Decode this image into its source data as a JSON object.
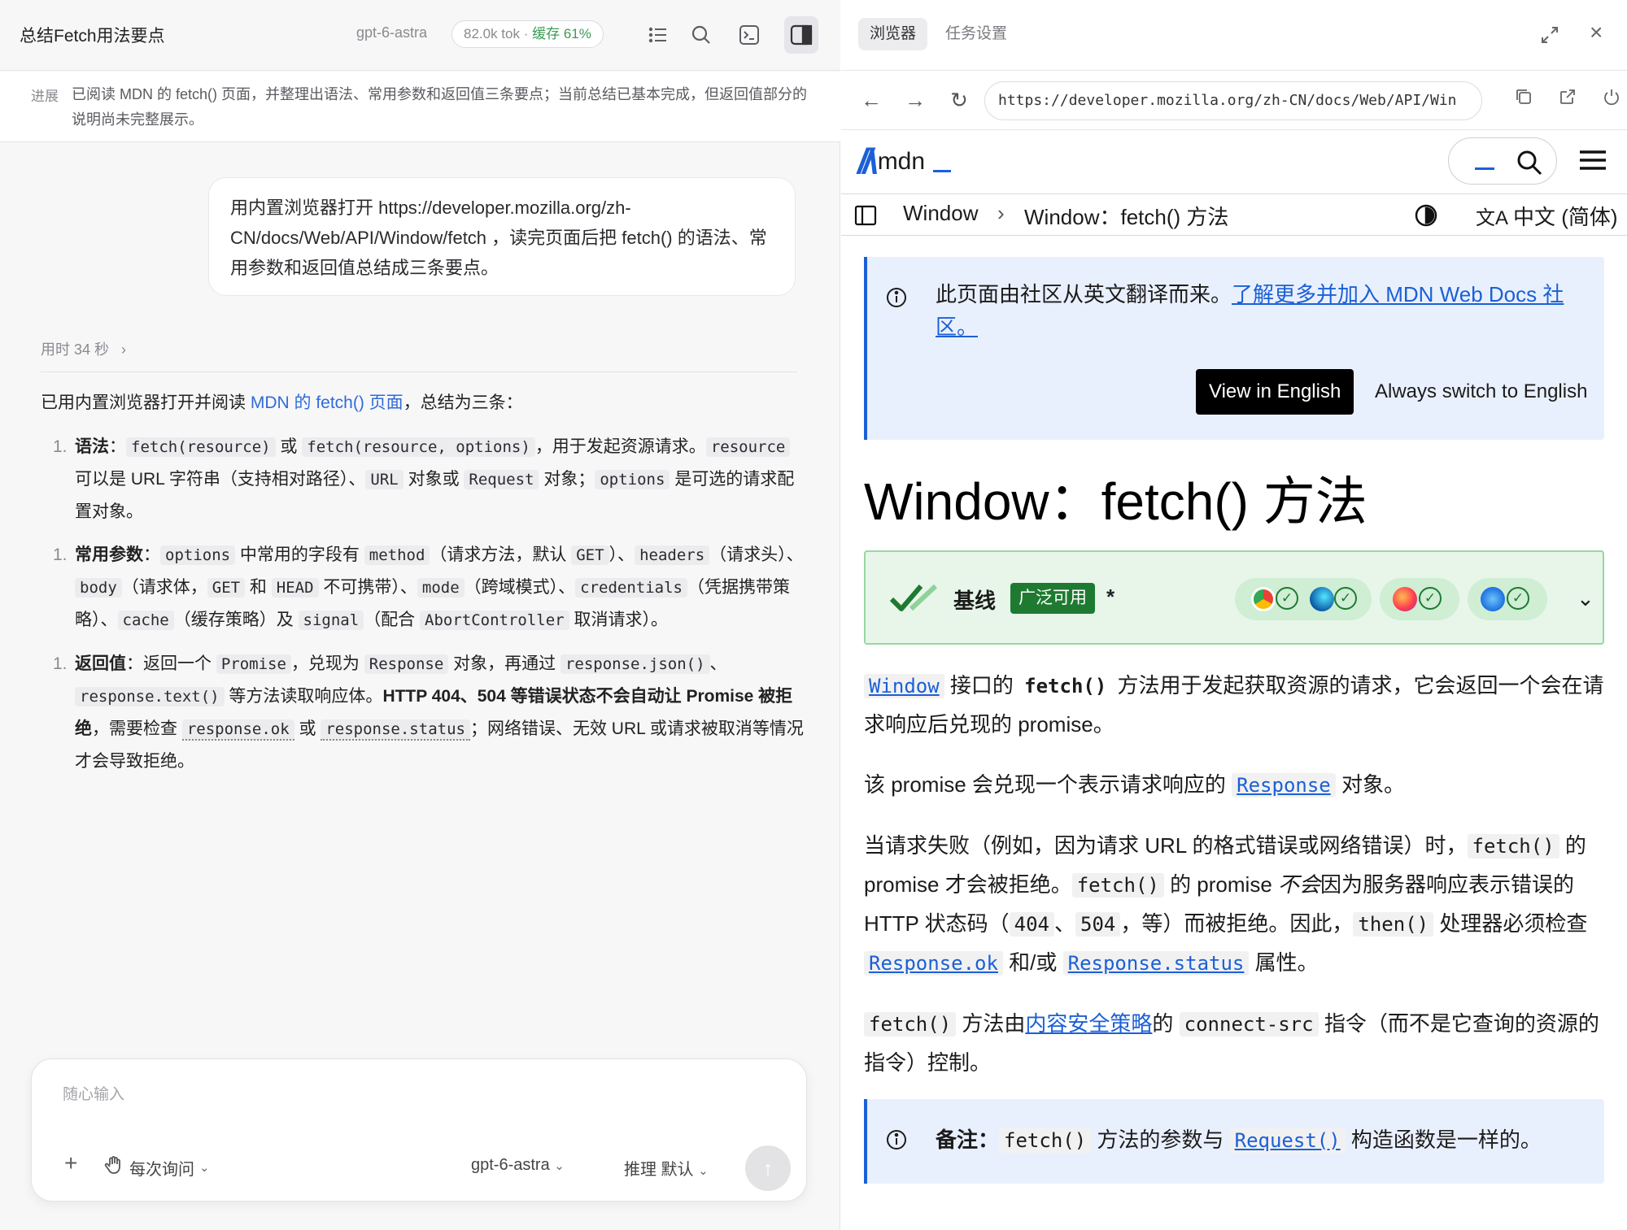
{
  "left": {
    "title": "总结Fetch用法要点",
    "model": "gpt-6-astra",
    "tokens": "82.0k tok · ",
    "cache": "缓存 61%",
    "progress_label": "进展",
    "progress_text": "已阅读 MDN 的 fetch() 页面，并整理出语法、常用参数和返回值三条要点；当前总结已基本完成，但返回值部分的说明尚未完整展示。",
    "user_message": "用内置浏览器打开 https://developer.mozilla.org/zh-CN/docs/Web/API/Window/fetch ，读完页面后把 fetch() 的语法、常用参数和返回值总结成三条要点。",
    "elapsed": "用时 34 秒",
    "answer_intro_pre": "已用内置浏览器打开并阅读 ",
    "answer_intro_link": "MDN 的 fetch() 页面",
    "answer_intro_post": "，总结为三条：",
    "item1": {
      "num": "1.",
      "title": "语法",
      "colon": "：",
      "c1": "fetch(resource)",
      "t1": " 或 ",
      "c2": "fetch(resource, options)",
      "t2": "，用于发起资源请求。",
      "c3": "resource",
      "t3": " 可以是 URL 字符串（支持相对路径）、",
      "c4": "URL",
      "t4": " 对象或 ",
      "c5": "Request",
      "t5": " 对象；",
      "c6": "options",
      "t6": " 是可选的请求配置对象。"
    },
    "item2": {
      "num": "1.",
      "title": "常用参数",
      "colon": "：",
      "c1": "options",
      "t1": " 中常用的字段有 ",
      "c2": "method",
      "t2": "（请求方法，默认 ",
      "c3": "GET",
      "t3": "）、",
      "c4": "headers",
      "t4": "（请求头）、",
      "c5": "body",
      "t5": "（请求体，",
      "c6": "GET",
      "t6": " 和 ",
      "c7": "HEAD",
      "t7": " 不可携带）、",
      "c8": "mode",
      "t8": "（跨域模式）、",
      "c9": "credentials",
      "t9": "（凭据携带策略）、",
      "c10": "cache",
      "t10": "（缓存策略）及 ",
      "c11": "signal",
      "t11": "（配合 ",
      "c12": "AbortController",
      "t12": " 取消请求）。"
    },
    "item3": {
      "num": "1.",
      "title": "返回值",
      "colon": "：",
      "t0": "返回一个 ",
      "c1": "Promise",
      "t1": "，兑现为 ",
      "c2": "Response",
      "t2": " 对象，再通过 ",
      "c3": "response.json()",
      "t3": "、",
      "c4": "response.text()",
      "t4": " 等方法读取响应体。",
      "b1": "HTTP 404、504 等错误状态不会自动让 Promise 被拒绝",
      "t5": "，需要检查 ",
      "c5": "response.ok",
      "t6": " 或 ",
      "c6": "response.status",
      "t7": "；网络错误、无效 URL 或请求被取消等情况才会导致拒绝。"
    },
    "composer": {
      "placeholder": "随心输入",
      "plus": "+",
      "ask_mode": "每次询问",
      "model": "gpt-6-astra",
      "reasoning": "推理 默认"
    }
  },
  "right": {
    "tab_browser": "浏览器",
    "tab_task": "任务设置",
    "close": "×",
    "url": "https://developer.mozilla.org/zh-CN/docs/Web/API/Win",
    "mdn_logo_text": "mdn",
    "crumb1": "Window",
    "crumb_sep": "›",
    "crumb2": "Window：fetch() 方法",
    "lang": "中文 (简体)",
    "notice_text": "此页面由社区从英文翻译而来。",
    "notice_link": "了解更多并加入 MDN Web Docs 社区。",
    "view_english": "View in English",
    "always_english": "Always switch to English",
    "page_title": "Window：fetch() 方法",
    "baseline_label": "基线",
    "baseline_badge": "广泛可用",
    "baseline_star": "*",
    "p1": {
      "link": "Window",
      "t1": " 接口的 ",
      "b1": "fetch()",
      "t2": " 方法用于发起获取资源的请求，它会返回一个会在请求响应后兑现的 promise。"
    },
    "p2": {
      "t1": "该 promise 会兑现一个表示请求响应的 ",
      "link": "Response",
      "t2": " 对象。"
    },
    "p3": {
      "t1": "当请求失败（例如，因为请求 URL 的格式错误或网络错误）时，",
      "c1": "fetch()",
      "t2": " 的 promise 才会被拒绝。",
      "c2": "fetch()",
      "t3": " 的 promise ",
      "i1": "不会",
      "t4": "因为服务器响应表示错误的 HTTP 状态码（",
      "c3": "404",
      "t5": "、",
      "c4": "504",
      "t6": "，等）而被拒绝。因此，",
      "c5": "then()",
      "t7": " 处理器必须检查 ",
      "l1": "Response.ok",
      "t8": " 和/或 ",
      "l2": "Response.status",
      "t9": " 属性。"
    },
    "p4": {
      "c1": "fetch()",
      "t1": " 方法由",
      "link": "内容安全策略",
      "t2": "的 ",
      "c2": "connect-src",
      "t3": " 指令（而不是它查询的资源的指令）控制。"
    },
    "note": {
      "label": "备注：",
      "c1": "fetch()",
      "t1": " 方法的参数与 ",
      "link": "Request()",
      "t2": " 构造函数是一样的。"
    }
  }
}
